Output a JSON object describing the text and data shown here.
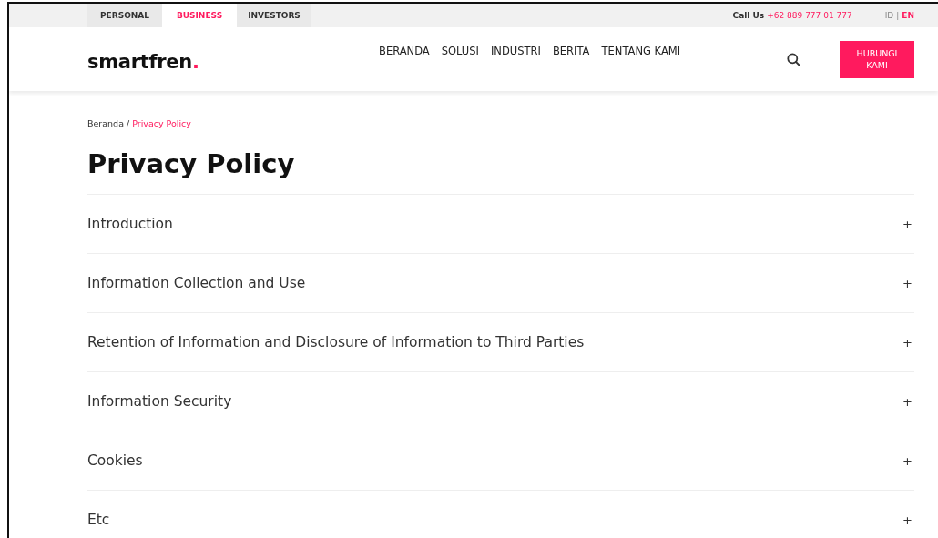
{
  "top_tabs": [
    {
      "label": "PERSONAL",
      "selected": false
    },
    {
      "label": "BUSINESS",
      "selected": true
    },
    {
      "label": "INVESTORS",
      "selected": false
    }
  ],
  "call": {
    "label": "Call Us",
    "number": "+62 889 777 01 777"
  },
  "languages": [
    {
      "label": "ID",
      "selected": false
    },
    {
      "label": "EN",
      "selected": true
    }
  ],
  "language_separator": "|",
  "logo": {
    "text": "smartfren",
    "dot": "."
  },
  "nav": [
    "BERANDA",
    "SOLUSI",
    "INDUSTRI",
    "BERITA",
    "TENTANG KAMI"
  ],
  "contact_button": "HUBUNGI KAMI",
  "breadcrumb": {
    "home": "Beranda",
    "separator": "/",
    "current": "Privacy Policy"
  },
  "title": "Privacy Policy",
  "sections": [
    {
      "label": "Introduction",
      "expanded": false,
      "toggle": "+"
    },
    {
      "label": "Information Collection and Use",
      "expanded": false,
      "toggle": "+"
    },
    {
      "label": "Retention of Information and Disclosure of Information to Third Parties",
      "expanded": false,
      "toggle": "+"
    },
    {
      "label": "Information Security",
      "expanded": false,
      "toggle": "+"
    },
    {
      "label": "Cookies",
      "expanded": false,
      "toggle": "+"
    },
    {
      "label": "Etc",
      "expanded": false,
      "toggle": "+"
    }
  ]
}
